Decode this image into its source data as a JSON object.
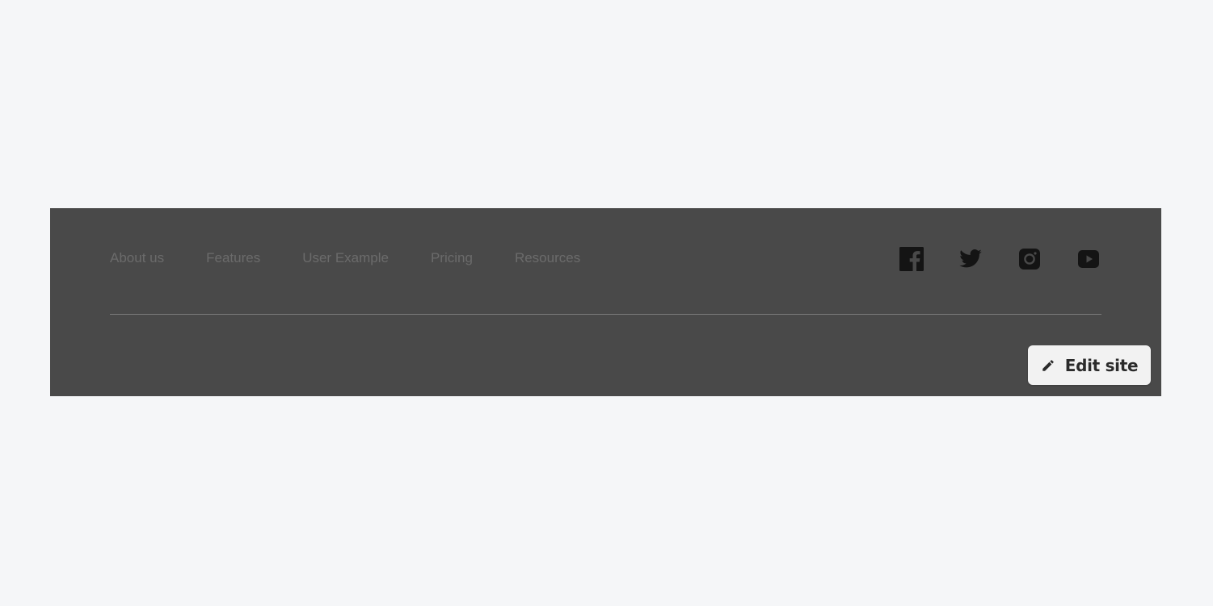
{
  "footer": {
    "nav_links": [
      {
        "label": "About us"
      },
      {
        "label": "Features"
      },
      {
        "label": "User Example"
      },
      {
        "label": "Pricing"
      },
      {
        "label": "Resources"
      }
    ],
    "social_icons": [
      "facebook-icon",
      "twitter-icon",
      "instagram-icon",
      "youtube-icon"
    ],
    "icon_color": "#141414",
    "background": "#494949"
  },
  "edit_button": {
    "label": "Edit site",
    "icon": "pencil-icon"
  }
}
